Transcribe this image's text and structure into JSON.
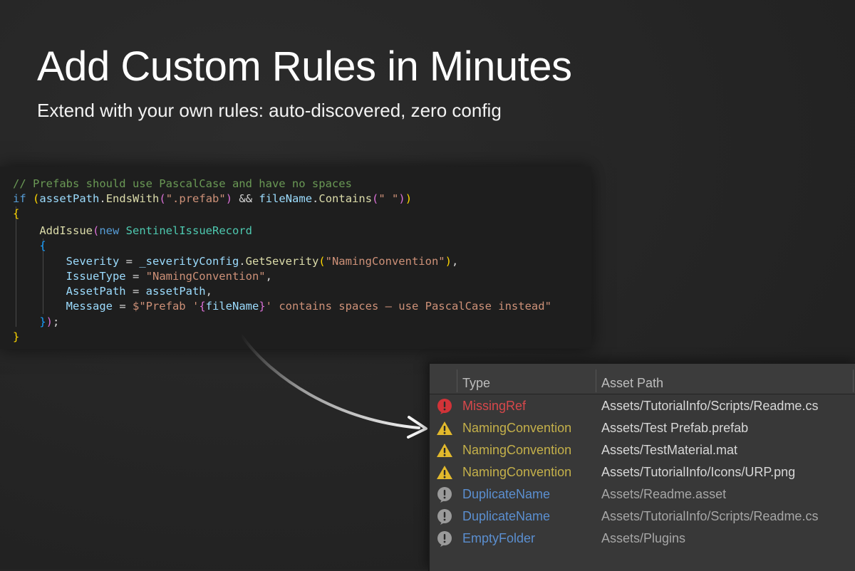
{
  "header": {
    "title": "Add Custom Rules in Minutes",
    "subtitle": "Extend with your own rules:  auto-discovered, zero config"
  },
  "code": {
    "lines": [
      [
        {
          "t": "// Prefabs should use PascalCase and have no spaces",
          "c": "comment"
        }
      ],
      [
        {
          "t": "if",
          "c": "kw"
        },
        {
          "t": " ",
          "c": "plain"
        },
        {
          "t": "(",
          "c": "b1"
        },
        {
          "t": "assetPath",
          "c": "var"
        },
        {
          "t": ".",
          "c": "plain"
        },
        {
          "t": "EndsWith",
          "c": "fn"
        },
        {
          "t": "(",
          "c": "b2"
        },
        {
          "t": "\".prefab\"",
          "c": "str"
        },
        {
          "t": ")",
          "c": "b2"
        },
        {
          "t": " && ",
          "c": "plain"
        },
        {
          "t": "fileName",
          "c": "var"
        },
        {
          "t": ".",
          "c": "plain"
        },
        {
          "t": "Contains",
          "c": "fn"
        },
        {
          "t": "(",
          "c": "b2"
        },
        {
          "t": "\" \"",
          "c": "str"
        },
        {
          "t": ")",
          "c": "b2"
        },
        {
          "t": ")",
          "c": "b1"
        }
      ],
      [
        {
          "t": "{",
          "c": "b1"
        }
      ],
      [
        {
          "t": "    ",
          "c": "plain"
        },
        {
          "t": "AddIssue",
          "c": "fn"
        },
        {
          "t": "(",
          "c": "b2"
        },
        {
          "t": "new",
          "c": "kw"
        },
        {
          "t": " ",
          "c": "plain"
        },
        {
          "t": "SentinelIssueRecord",
          "c": "type"
        }
      ],
      [
        {
          "t": "    ",
          "c": "plain"
        },
        {
          "t": "{",
          "c": "b3"
        }
      ],
      [
        {
          "t": "        ",
          "c": "plain"
        },
        {
          "t": "Severity",
          "c": "var"
        },
        {
          "t": " = ",
          "c": "plain"
        },
        {
          "t": "_severityConfig",
          "c": "var"
        },
        {
          "t": ".",
          "c": "plain"
        },
        {
          "t": "GetSeverity",
          "c": "fn"
        },
        {
          "t": "(",
          "c": "b1"
        },
        {
          "t": "\"NamingConvention\"",
          "c": "str"
        },
        {
          "t": ")",
          "c": "b1"
        },
        {
          "t": ",",
          "c": "plain"
        }
      ],
      [
        {
          "t": "        ",
          "c": "plain"
        },
        {
          "t": "IssueType",
          "c": "var"
        },
        {
          "t": " = ",
          "c": "plain"
        },
        {
          "t": "\"NamingConvention\"",
          "c": "str"
        },
        {
          "t": ",",
          "c": "plain"
        }
      ],
      [
        {
          "t": "        ",
          "c": "plain"
        },
        {
          "t": "AssetPath",
          "c": "var"
        },
        {
          "t": " = ",
          "c": "plain"
        },
        {
          "t": "assetPath",
          "c": "var"
        },
        {
          "t": ",",
          "c": "plain"
        }
      ],
      [
        {
          "t": "        ",
          "c": "plain"
        },
        {
          "t": "Message",
          "c": "var"
        },
        {
          "t": " = ",
          "c": "plain"
        },
        {
          "t": "$\"Prefab '",
          "c": "str"
        },
        {
          "t": "{",
          "c": "b2"
        },
        {
          "t": "fileName",
          "c": "var"
        },
        {
          "t": "}",
          "c": "b2"
        },
        {
          "t": "' contains spaces — use PascalCase instead\"",
          "c": "str"
        }
      ],
      [
        {
          "t": "    ",
          "c": "plain"
        },
        {
          "t": "}",
          "c": "b3"
        },
        {
          "t": ")",
          "c": "b2"
        },
        {
          "t": ";",
          "c": "plain"
        }
      ],
      [
        {
          "t": "}",
          "c": "b1"
        }
      ]
    ]
  },
  "issues_table": {
    "columns": [
      "Type",
      "Asset Path"
    ],
    "rows": [
      {
        "severity": "error",
        "type": "MissingRef",
        "path": "Assets/TutorialInfo/Scripts/Readme.cs"
      },
      {
        "severity": "warning",
        "type": "NamingConvention",
        "path": "Assets/Test Prefab.prefab"
      },
      {
        "severity": "warning",
        "type": "NamingConvention",
        "path": "Assets/TestMaterial.mat"
      },
      {
        "severity": "warning",
        "type": "NamingConvention",
        "path": "Assets/TutorialInfo/Icons/URP.png"
      },
      {
        "severity": "info",
        "type": "DuplicateName",
        "path": "Assets/Readme.asset"
      },
      {
        "severity": "info",
        "type": "DuplicateName",
        "path": "Assets/TutorialInfo/Scripts/Readme.cs"
      },
      {
        "severity": "info",
        "type": "EmptyFolder",
        "path": "Assets/Plugins"
      }
    ]
  },
  "colors": {
    "error_type": "#d8484b",
    "warning_type": "#c4b04a",
    "info_type": "#5b8fd0",
    "path_normal": "#d7d7d7",
    "path_dim": "#a6a6a6",
    "error_icon": "#d23338",
    "warning_icon": "#e2b92c",
    "info_icon": "#9a9a9a"
  },
  "icons": {
    "error": "error-icon",
    "warning": "warning-icon",
    "info": "info-icon"
  }
}
